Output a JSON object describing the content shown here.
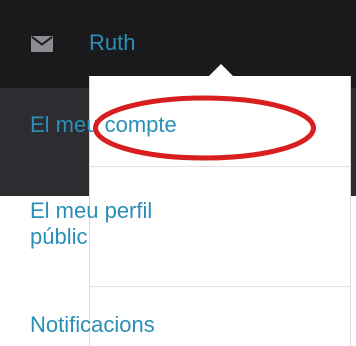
{
  "header": {
    "mail_icon": "envelope-icon",
    "user_name": "Ruth"
  },
  "menu": {
    "items": [
      {
        "label": "El meu compte"
      },
      {
        "label_line1": "El meu perfil",
        "label_line2": "públic"
      },
      {
        "label": "Notificacions"
      }
    ]
  },
  "colors": {
    "top_bar": "#1a1a1d",
    "sub_bar": "#2c2c31",
    "link": "#2b8fb8",
    "highlight": "#d81e1e"
  }
}
